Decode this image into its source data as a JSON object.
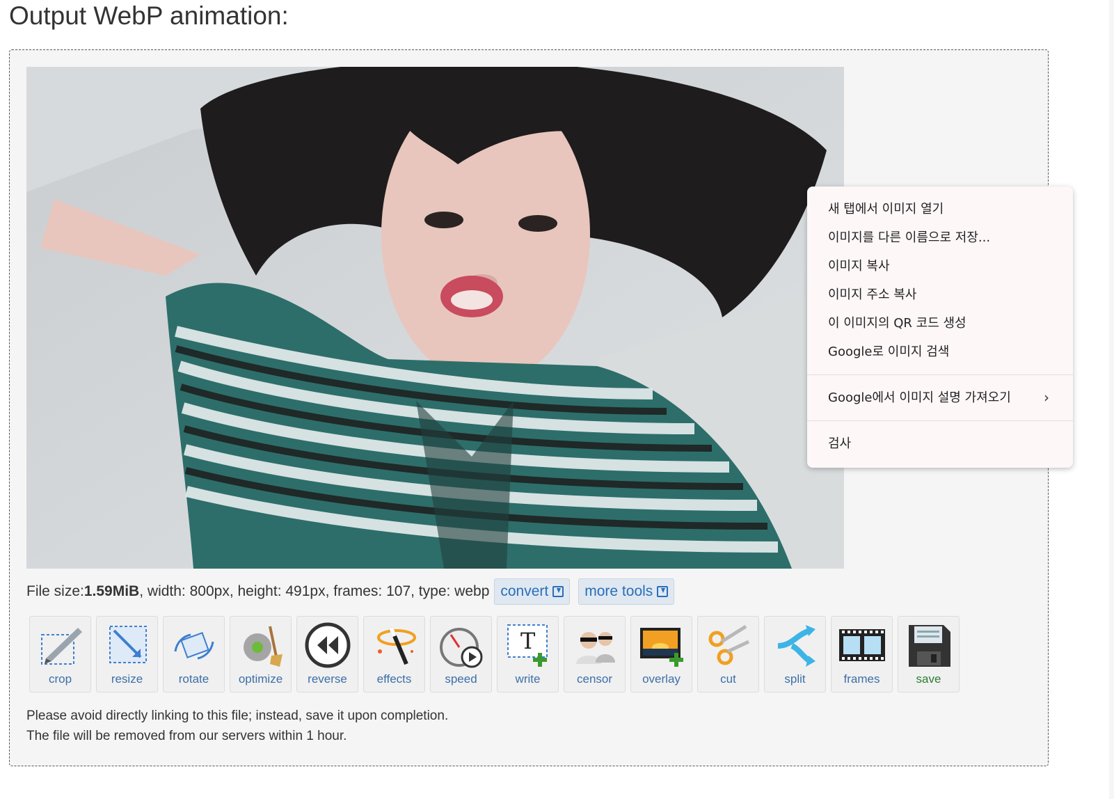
{
  "page": {
    "title": "Output WebP animation:"
  },
  "file_info": {
    "size_label": "File size: ",
    "size_value": "1.59MiB",
    "details": ", width: 800px, height: 491px, frames: 107, type: webp",
    "convert_label": "convert",
    "more_tools_label": "more tools"
  },
  "tools": [
    {
      "label": "crop",
      "icon": "crop-icon"
    },
    {
      "label": "resize",
      "icon": "resize-icon"
    },
    {
      "label": "rotate",
      "icon": "rotate-icon"
    },
    {
      "label": "optimize",
      "icon": "optimize-icon"
    },
    {
      "label": "reverse",
      "icon": "reverse-icon"
    },
    {
      "label": "effects",
      "icon": "effects-icon"
    },
    {
      "label": "speed",
      "icon": "speed-icon"
    },
    {
      "label": "write",
      "icon": "write-icon"
    },
    {
      "label": "censor",
      "icon": "censor-icon"
    },
    {
      "label": "overlay",
      "icon": "overlay-icon"
    },
    {
      "label": "cut",
      "icon": "cut-icon"
    },
    {
      "label": "split",
      "icon": "split-icon"
    },
    {
      "label": "frames",
      "icon": "frames-icon"
    },
    {
      "label": "save",
      "icon": "save-icon"
    }
  ],
  "notice": {
    "line1": "Please avoid directly linking to this file; instead, save it upon completion.",
    "line2": "The file will be removed from our servers within 1 hour."
  },
  "context_menu": {
    "items": [
      "새 탭에서 이미지 열기",
      "이미지를 다른 이름으로 저장...",
      "이미지 복사",
      "이미지 주소 복사",
      "이 이미지의 QR 코드 생성",
      "Google로 이미지 검색",
      "Google에서 이미지 설명 가져오기",
      "검사"
    ],
    "submenu_chevron": "›"
  },
  "colors": {
    "link_blue": "#3c6fa8",
    "save_green": "#2e7d32",
    "box_bg": "#f5f5f5",
    "menu_bg": "#fdf7f8"
  }
}
